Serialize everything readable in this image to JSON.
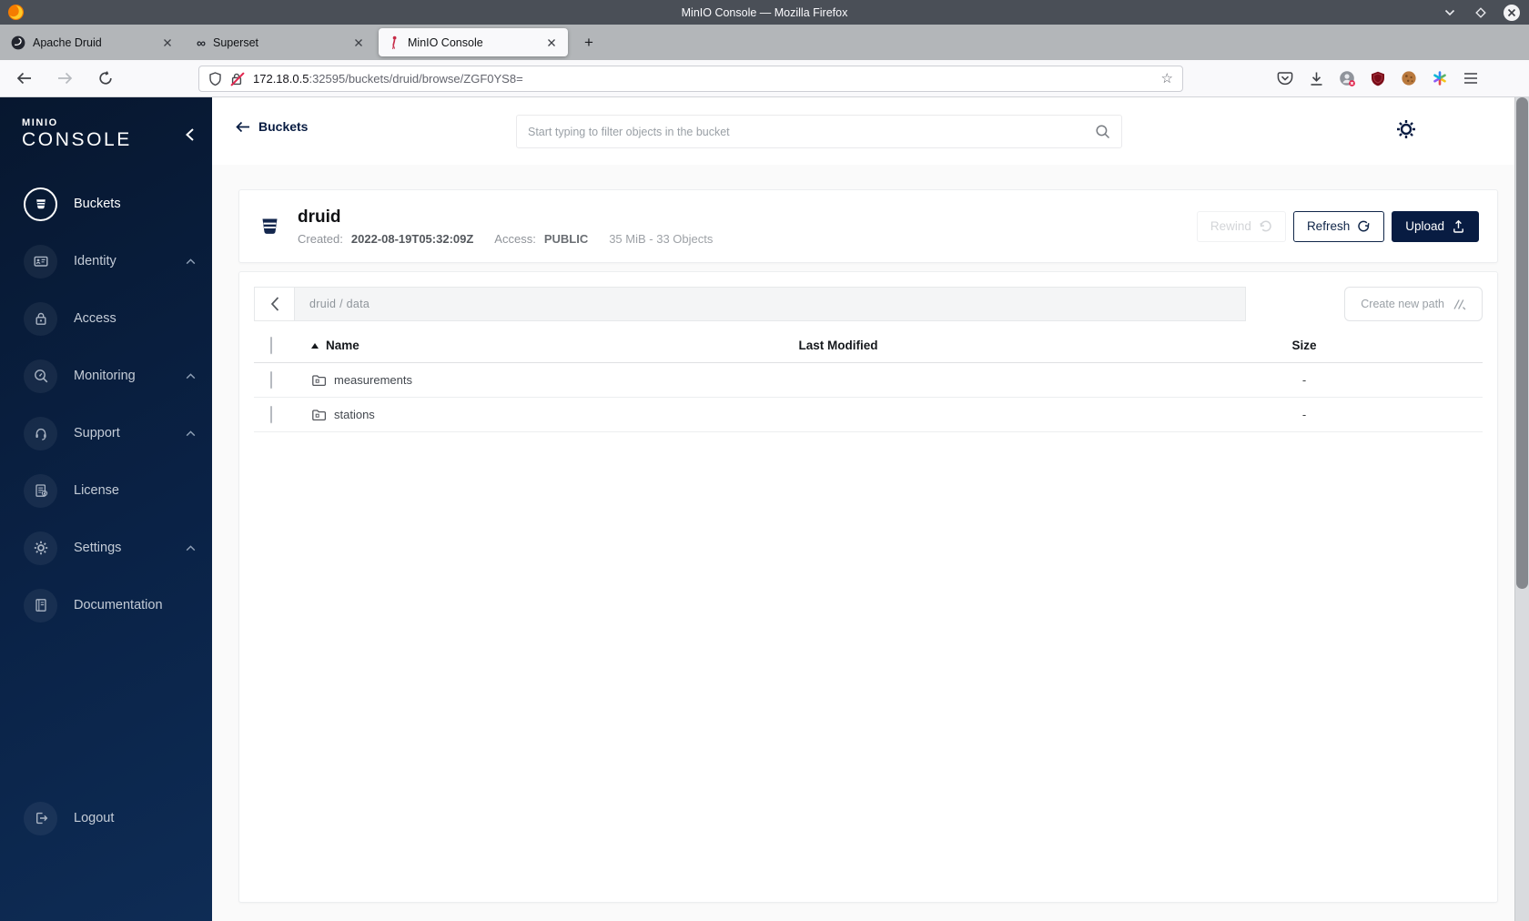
{
  "window": {
    "title": "MinIO Console — Mozilla Firefox"
  },
  "browser": {
    "tabs": [
      {
        "label": "Apache Druid"
      },
      {
        "label": "Superset"
      },
      {
        "label": "MinIO Console"
      }
    ],
    "new_tab_label": "+",
    "url": {
      "host": "172.18.0.5",
      "path": ":32595/buckets/druid/browse/ZGF0YS8="
    }
  },
  "icons": {
    "superset_favicon": "∞",
    "bookmark_star": "☆"
  },
  "sidebar": {
    "logo_line1": "MINIO",
    "logo_line2": "CONSOLE",
    "items": [
      {
        "label": "Buckets"
      },
      {
        "label": "Identity"
      },
      {
        "label": "Access"
      },
      {
        "label": "Monitoring"
      },
      {
        "label": "Support"
      },
      {
        "label": "License"
      },
      {
        "label": "Settings"
      },
      {
        "label": "Documentation"
      }
    ],
    "logout_label": "Logout"
  },
  "header": {
    "back_label": "Buckets",
    "search_placeholder": "Start typing to filter objects in the bucket"
  },
  "bucket": {
    "name": "druid",
    "created_label": "Created:",
    "created_value": "2022-08-19T05:32:09Z",
    "access_label": "Access:",
    "access_value": "PUBLIC",
    "usage": "35 MiB - 33 Objects",
    "rewind_label": "Rewind",
    "refresh_label": "Refresh",
    "upload_label": "Upload"
  },
  "browse": {
    "breadcrumb": "druid / data",
    "create_path_label": "Create new path"
  },
  "table": {
    "name_header": "Name",
    "modified_header": "Last Modified",
    "size_header": "Size",
    "rows": [
      {
        "name": "measurements",
        "size": "-"
      },
      {
        "name": "stations",
        "size": "-"
      }
    ]
  },
  "colors": {
    "accent_navy": "#081C42",
    "sidebar_top": "#07172F",
    "sidebar_bottom": "#0E2C55",
    "titlebar": "#4A4F57",
    "ublock_red": "#7a0c18"
  }
}
